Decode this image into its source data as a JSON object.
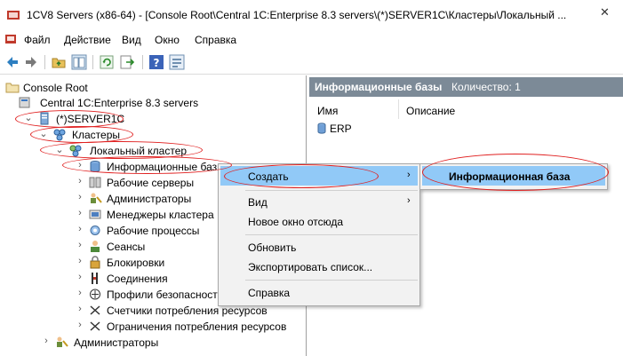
{
  "window": {
    "title": "1CV8 Servers (x86-64) - [Console Root\\Central 1C:Enterprise 8.3 servers\\(*)SERVER1C\\Кластеры\\Локальный ..."
  },
  "menu": [
    "Файл",
    "Действие",
    "Вид",
    "Окно",
    "Справка"
  ],
  "tree": {
    "root": "Console Root",
    "central": "Central 1C:Enterprise 8.3 servers",
    "server": "(*)SERVER1C",
    "clusters": "Кластеры",
    "local_cluster": "Локальный кластер",
    "items": [
      "Информационные базы",
      "Рабочие серверы",
      "Администраторы",
      "Менеджеры кластера",
      "Рабочие процессы",
      "Сеансы",
      "Блокировки",
      "Соединения",
      "Профили безопасности",
      "Счетчики потребления ресурсов",
      "Ограничения потребления ресурсов"
    ],
    "bottom": "Администраторы"
  },
  "right_pane": {
    "title": "Информационные базы",
    "count": "Количество: 1",
    "col_name": "Имя",
    "col_desc": "Описание",
    "rows": [
      "ERP"
    ]
  },
  "context_menu": {
    "create": "Создать",
    "view": "Вид",
    "new_window": "Новое окно отсюда",
    "refresh": "Обновить",
    "export": "Экспортировать список...",
    "help": "Справка"
  },
  "submenu": {
    "infobase": "Информационная база"
  }
}
